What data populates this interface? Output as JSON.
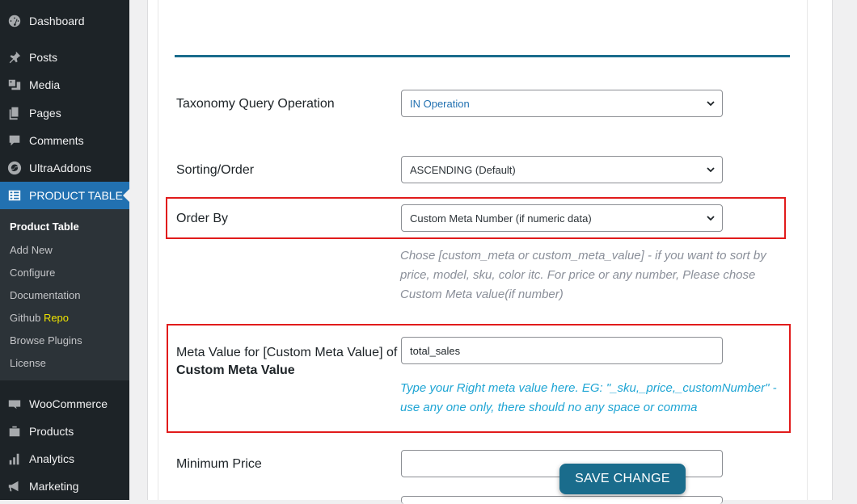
{
  "sidebar": {
    "items": [
      {
        "label": "Dashboard",
        "icon": "dashboard-icon"
      },
      {
        "label": "Posts",
        "icon": "pin-icon"
      },
      {
        "label": "Media",
        "icon": "media-icon"
      },
      {
        "label": "Pages",
        "icon": "pages-icon"
      },
      {
        "label": "Comments",
        "icon": "comments-icon"
      },
      {
        "label": "UltraAddons",
        "icon": "ultraaddons-icon"
      },
      {
        "label": "PRODUCT TABLE",
        "icon": "table-icon"
      },
      {
        "label": "WooCommerce",
        "icon": "woocommerce-icon"
      },
      {
        "label": "Products",
        "icon": "products-icon"
      },
      {
        "label": "Analytics",
        "icon": "analytics-icon"
      },
      {
        "label": "Marketing",
        "icon": "megaphone-icon"
      }
    ],
    "submenu": {
      "product_table": "Product Table",
      "add_new": "Add New",
      "configure": "Configure",
      "documentation": "Documentation",
      "github": "Github",
      "repo": "Repo",
      "browse_plugins": "Browse Plugins",
      "license": "License"
    }
  },
  "form": {
    "taxonomy": {
      "label": "Taxonomy Query Operation",
      "value": "IN Operation"
    },
    "sorting": {
      "label": "Sorting/Order",
      "value": "ASCENDING (Default)"
    },
    "order_by": {
      "label": "Order By",
      "value": "Custom Meta Number (if numeric data)",
      "help": "Chose [custom_meta or custom_meta_value] - if you want to sort by price, model, sku, color itc. For price or any number, Please chose Custom Meta value(if number)"
    },
    "meta_value": {
      "label_part1": "Meta Value for [Custom Meta Value] of",
      "label_bold": "Custom Meta Value",
      "value": "total_sales",
      "help": "Type your Right meta value here. EG: \"_sku,_price,_customNumber\" - use any one only, there should no any space or comma"
    },
    "min_price": {
      "label": "Minimum Price",
      "value": ""
    }
  },
  "save_button": "SAVE CHANGE",
  "colors": {
    "sidebar_bg": "#1d2327",
    "active_bg": "#2271b1",
    "accent": "#1a6c8c",
    "highlight_border": "#e11b1b"
  }
}
